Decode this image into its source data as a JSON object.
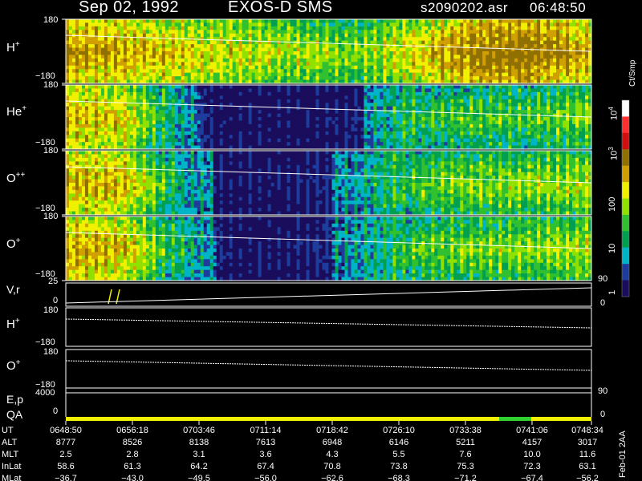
{
  "header": {
    "date": "Sep 02, 1992",
    "instrument": "EXOS-D SMS",
    "file": "s2090202.asr",
    "time": "06:48:50"
  },
  "panels": [
    {
      "label_main": "H",
      "label_sup": "+",
      "ymax": "180",
      "ymin": "−180"
    },
    {
      "label_main": "He",
      "label_sup": "+",
      "ymax": "180",
      "ymin": "−180"
    },
    {
      "label_main": "O",
      "label_sup": "++",
      "ymax": "180",
      "ymin": "−180"
    },
    {
      "label_main": "O",
      "label_sup": "+",
      "ymax": "180",
      "ymin": "−180"
    }
  ],
  "vr_panel": {
    "label": "V,r",
    "ymax": "25",
    "ymin": "0",
    "right_top": "90",
    "right_bottom": "0"
  },
  "h_line_panel": {
    "label_main": "H",
    "label_sup": "+",
    "ymax": "180",
    "ymin": "−180"
  },
  "o_line_panel": {
    "label_main": "O",
    "label_sup": "+",
    "ymax": "180",
    "ymin": "−180"
  },
  "ep_panel": {
    "label_top": "E,p",
    "label_bottom": "QA",
    "ytick": "4000",
    "ytick0": "0",
    "right_top": "90",
    "right_bottom": "0"
  },
  "colorbar": {
    "unit": "Ct/Smp",
    "ticks": [
      "10",
      "10",
      "100",
      "10",
      "10"
    ],
    "tick_sups": [
      "4",
      "3",
      "",
      "",
      ""
    ],
    "tick_labels": [
      "10⁴",
      "10³",
      "100",
      "10",
      "1"
    ]
  },
  "footer": {
    "stamp": "Feb-01 2AA",
    "row_labels": [
      "UT",
      "ALT",
      "MLT",
      "InLat",
      "MLat"
    ],
    "columns": [
      {
        "ut": "0648:50",
        "alt": "8777",
        "mlt": "2.5",
        "inlat": "58.6",
        "mlat": "−36.7"
      },
      {
        "ut": "0656:18",
        "alt": "8526",
        "mlt": "2.8",
        "inlat": "61.3",
        "mlat": "−43.0"
      },
      {
        "ut": "0703:46",
        "alt": "8138",
        "mlt": "3.1",
        "inlat": "64.2",
        "mlat": "−49.5"
      },
      {
        "ut": "0711:14",
        "alt": "7613",
        "mlt": "3.6",
        "inlat": "67.4",
        "mlat": "−56.0"
      },
      {
        "ut": "0718:42",
        "alt": "6948",
        "mlt": "4.3",
        "inlat": "70.8",
        "mlat": "−62.6"
      },
      {
        "ut": "0726:10",
        "alt": "6146",
        "mlt": "5.5",
        "inlat": "73.8",
        "mlat": "−68.3"
      },
      {
        "ut": "0733:38",
        "alt": "5211",
        "mlt": "7.6",
        "inlat": "75.3",
        "mlat": "−71.2"
      },
      {
        "ut": "0741:06",
        "alt": "4157",
        "mlt": "10.0",
        "inlat": "72.3",
        "mlat": "−67.4"
      },
      {
        "ut": "0748:34",
        "alt": "3017",
        "mlt": "11.6",
        "inlat": "63.1",
        "mlat": "−56.2"
      }
    ]
  },
  "chart_data": {
    "type": "heatmap",
    "x_ticks": [
      "0648:50",
      "0656:18",
      "0703:46",
      "0711:14",
      "0718:42",
      "0726:10",
      "0733:38",
      "0741:06",
      "0748:34"
    ],
    "y_range": [
      -180,
      180
    ],
    "colorscale": [
      "#1a0d5c",
      "#1e3c9c",
      "#00b4c8",
      "#00a050",
      "#30c030",
      "#90e000",
      "#f0f000",
      "#d0a000",
      "#907000",
      "#d01010",
      "#ff3030",
      "#ffffff"
    ],
    "series": [
      {
        "name": "H+",
        "intensity_profile": [
          0.65,
          0.62,
          0.55,
          0.5,
          0.45,
          0.4,
          0.55,
          0.7,
          0.72,
          0.6
        ]
      },
      {
        "name": "He+",
        "intensity_profile": [
          0.6,
          0.55,
          0.15,
          0.05,
          0.05,
          0.1,
          0.3,
          0.35,
          0.35,
          0.4
        ]
      },
      {
        "name": "O++",
        "intensity_profile": [
          0.62,
          0.58,
          0.2,
          0.05,
          0.08,
          0.15,
          0.35,
          0.4,
          0.42,
          0.45
        ]
      },
      {
        "name": "O+",
        "intensity_profile": [
          0.62,
          0.58,
          0.22,
          0.05,
          0.08,
          0.15,
          0.35,
          0.4,
          0.42,
          0.45
        ]
      }
    ],
    "pitch_line_start": 90,
    "pitch_line_end": 0,
    "qa_bar_colors": [
      "#f0f000",
      "#30d030"
    ]
  }
}
